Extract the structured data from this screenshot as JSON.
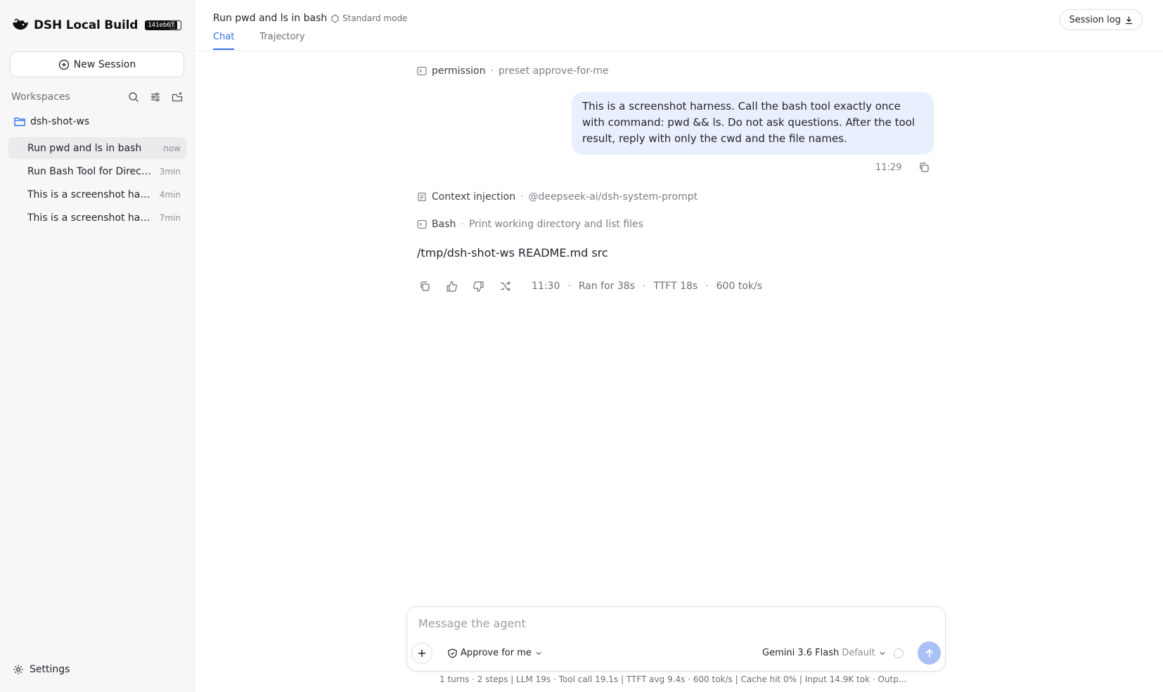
{
  "brand": {
    "name": "DSH Local Build",
    "build_hash": "141eb6f"
  },
  "sidebar": {
    "new_session_label": "New Session",
    "workspaces_title": "Workspaces",
    "workspace_name": "dsh-shot-ws",
    "sessions": [
      {
        "title": "Run pwd and ls in bash",
        "time": "now",
        "active": true
      },
      {
        "title": "Run Bash Tool for Director...",
        "time": "3min"
      },
      {
        "title": "This is a screenshot harne...",
        "time": "4min"
      },
      {
        "title": "This is a screenshot harne...",
        "time": "7min"
      }
    ],
    "settings_label": "Settings"
  },
  "header": {
    "title": "Run pwd and ls in bash",
    "mode": "Standard mode",
    "tabs": [
      {
        "label": "Chat",
        "active": true
      },
      {
        "label": "Trajectory"
      }
    ],
    "session_log_label": "Session log"
  },
  "chat": {
    "permission_step": {
      "label": "permission",
      "detail": "preset approve-for-me"
    },
    "user_message": "This is a screenshot harness. Call the bash tool exactly once with command: pwd && ls. Do not ask questions. After the tool result, reply with only the cwd and the file names.",
    "user_message_time": "11:29",
    "context_step": {
      "label": "Context injection",
      "detail": "@deepseek-ai/dsh-system-prompt"
    },
    "bash_step": {
      "label": "Bash",
      "detail": "Print working directory and list files"
    },
    "answer": "/tmp/dsh-shot-ws README.md src",
    "meta": {
      "time": "11:30",
      "ran_for": "Ran for 38s",
      "ttft": "TTFT 18s",
      "speed": "600 tok/s"
    }
  },
  "composer": {
    "placeholder": "Message the agent",
    "value": "",
    "approve_label": "Approve for me",
    "model_name": "Gemini 3.6 Flash",
    "model_tag": "Default"
  },
  "stats": "1 turns · 2 steps   |   LLM 19s · Tool call 19.1s   |   TTFT avg 9.4s · 600 tok/s   |   Cache hit 0%   |   Input 14.9K tok · Outp...",
  "colors": {
    "accent": "#2f6fed",
    "user_bubble": "#e9effd",
    "send_button": "#a9c1f6",
    "sidebar_bg": "#f7f7f8"
  }
}
